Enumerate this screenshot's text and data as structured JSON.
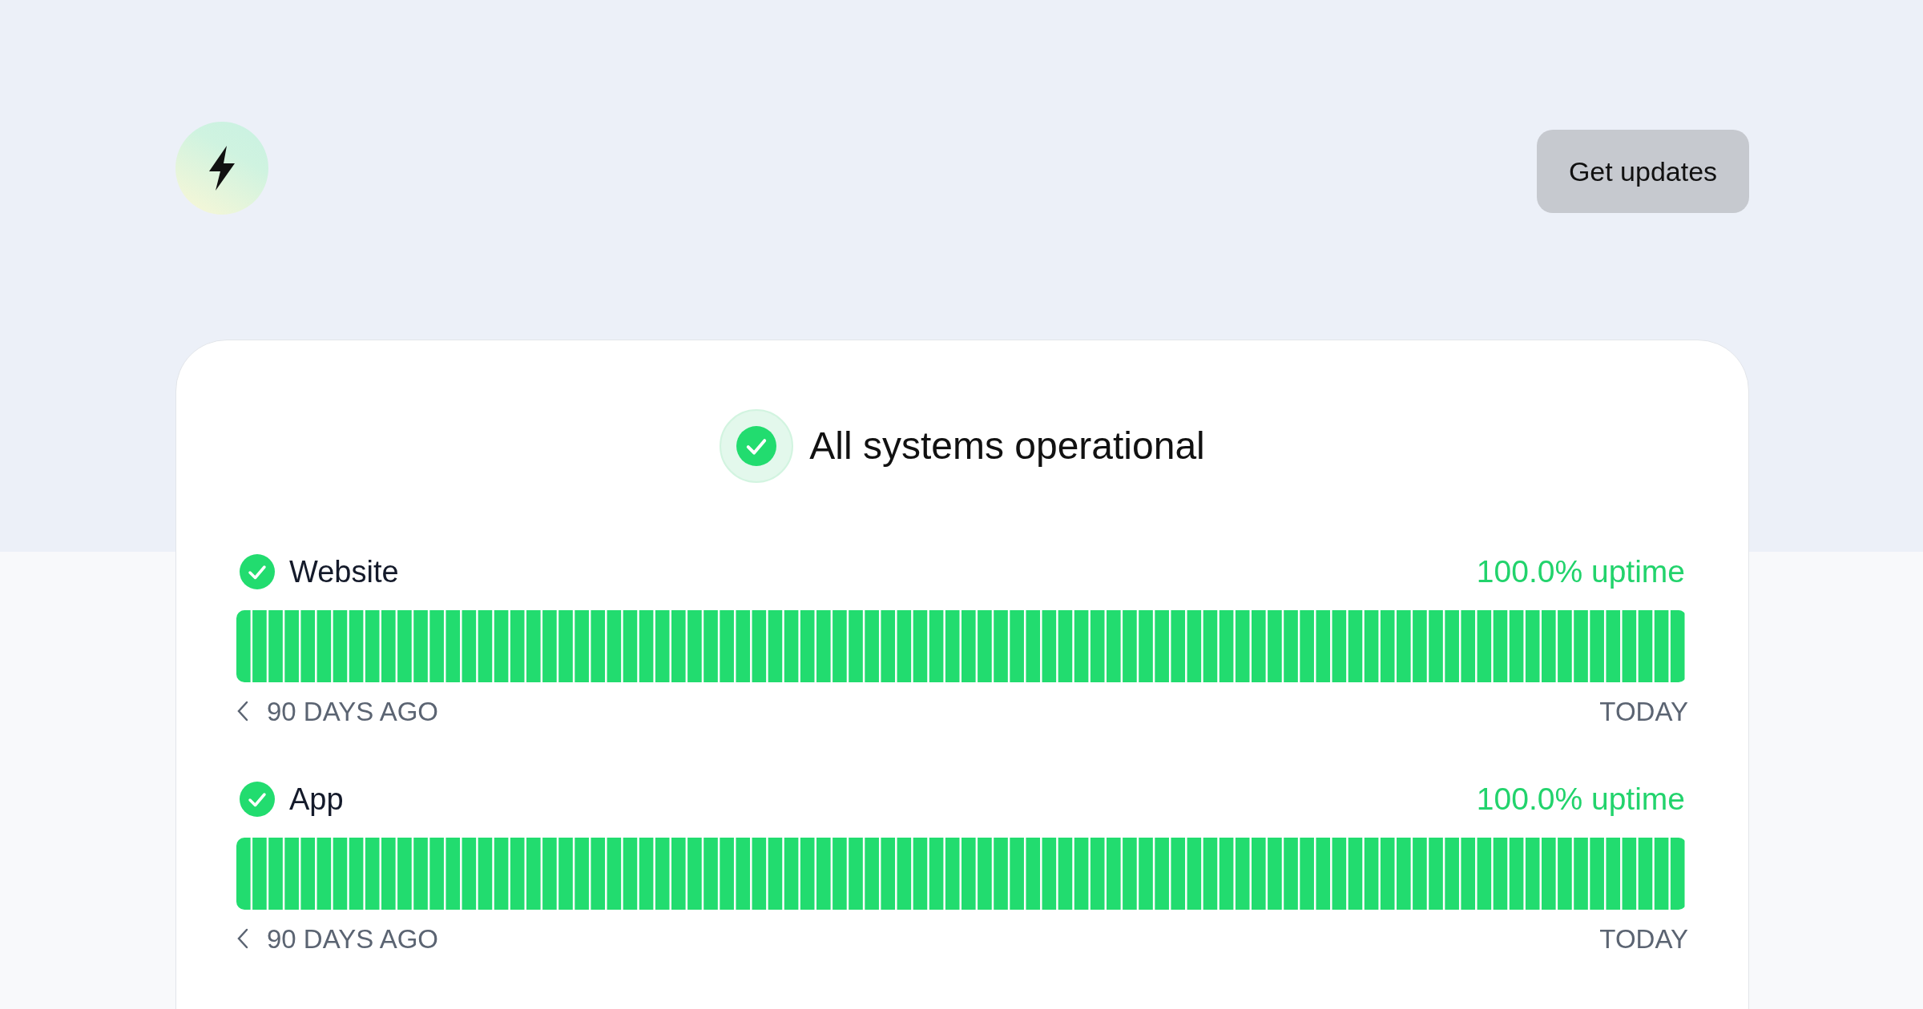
{
  "header": {
    "button": "Get updates"
  },
  "overall": {
    "operational": true,
    "title": "All systems operational"
  },
  "services": [
    {
      "name": "Website",
      "operational": true,
      "uptime": "100.0% uptime",
      "start_label": "90 DAYS AGO",
      "end_label": "TODAY"
    },
    {
      "name": "App",
      "operational": true,
      "uptime": "100.0% uptime",
      "start_label": "90 DAYS AGO",
      "end_label": "TODAY"
    }
  ]
}
